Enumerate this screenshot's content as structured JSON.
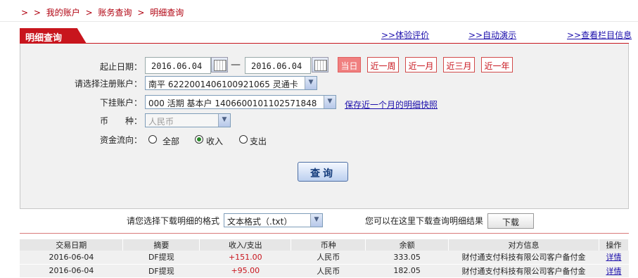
{
  "breadcrumb": {
    "sep": ">",
    "items": [
      "我的账户",
      "账务查询",
      "明细查询"
    ]
  },
  "title": "明细查询",
  "top_links": [
    "体验评价",
    "自动演示",
    "查看栏目信息"
  ],
  "top_link_prefix": ">>",
  "form": {
    "date_label": "起止日期：",
    "start_date": "2016.06.04",
    "end_date": "2016.06.04",
    "range_dash": "—",
    "quick_buttons": [
      {
        "label": "当日",
        "active": true
      },
      {
        "label": "近一周",
        "active": false
      },
      {
        "label": "近一月",
        "active": false
      },
      {
        "label": "近三月",
        "active": false
      },
      {
        "label": "近一年",
        "active": false
      }
    ],
    "account_label": "请选择注册账户：",
    "account_value": "南平  6222001406100921065  灵通卡",
    "sub_account_label": "下挂账户：",
    "sub_account_value": "000  活期  基本户  1406600101102571848",
    "snapshot_link": "保存近一个月的明细快照",
    "currency_label": "币　　种：",
    "currency_value": "人民币",
    "flow_label": "资金流向：",
    "flow_options": [
      {
        "label": "全部",
        "selected": false
      },
      {
        "label": "收入",
        "selected": true
      },
      {
        "label": "支出",
        "selected": false
      }
    ],
    "query_button": "查询"
  },
  "download": {
    "format_label": "请您选择下载明细的格式",
    "format_value": "文本格式（.txt）",
    "hint": "您可以在这里下载查询明细结果",
    "button": "下载"
  },
  "table": {
    "headers": [
      "交易日期",
      "摘要",
      "收入/支出",
      "币种",
      "余额",
      "对方信息",
      "操作"
    ],
    "rows": [
      [
        "2016-06-04",
        "DF提现",
        "+151.00",
        "人民币",
        "333.05",
        "财付通支付科技有限公司客户备付金",
        "详情"
      ],
      [
        "2016-06-04",
        "DF提现",
        "+95.00",
        "人民币",
        "182.05",
        "财付通支付科技有限公司客户备付金",
        "详情"
      ]
    ]
  },
  "colors": {
    "brand_red": "#c8151d",
    "link_blue": "#1a0dab",
    "active_quick": "#f08080"
  }
}
